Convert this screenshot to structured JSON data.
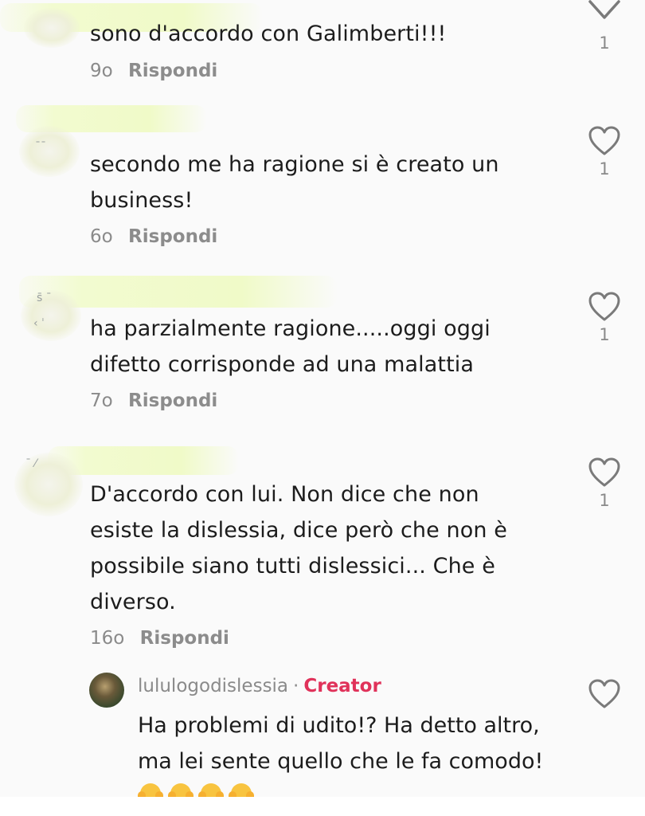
{
  "comments": [
    {
      "text": "sono d'accordo con Galimberti!!!",
      "age": "9o",
      "reply_label": "Rispondi",
      "likes": "1"
    },
    {
      "text": "secondo me ha ragione si è creato un business!",
      "age": "6o",
      "reply_label": "Rispondi",
      "likes": "1"
    },
    {
      "text": "ha parzialmente ragione.....oggi oggi difetto corrisponde ad una malattia",
      "age": "7o",
      "reply_label": "Rispondi",
      "likes": "1"
    },
    {
      "text": "D'accordo con lui. Non dice che non esiste la dislessia, dice però che non è possibile siano tutti dislessici... Che è diverso.",
      "age": "16o",
      "reply_label": "Rispondi",
      "likes": "1"
    }
  ],
  "reply": {
    "username": "lululogodislessia",
    "separator": "·",
    "badge": "Creator",
    "text": "Ha problemi di udito!? Ha detto altro, ma lei sente quello che le fa comodo!",
    "emoji_count": 4,
    "emoji_name": "face-with-hands-over-mouth"
  },
  "colors": {
    "creator_badge": "#e0325a",
    "meta_text": "#8a8a8a",
    "body_text": "#1c1c1c"
  },
  "icons": {
    "like": "heart-outline-icon",
    "collapse": "chevron-down-icon"
  }
}
